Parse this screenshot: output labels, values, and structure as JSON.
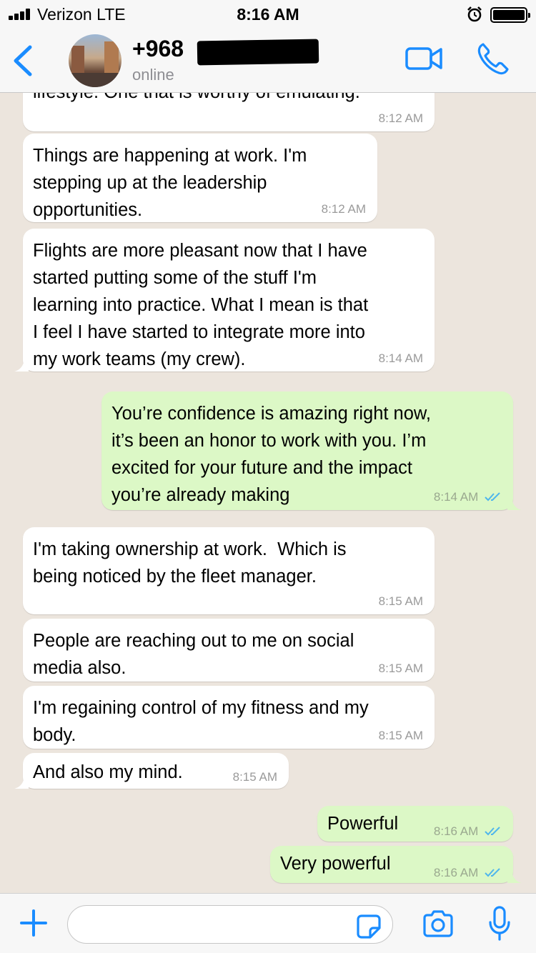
{
  "status_bar": {
    "carrier": "Verizon  LTE",
    "time": "8:16 AM"
  },
  "header": {
    "back_icon": "chevron-left-icon",
    "contact_name": "+968",
    "contact_status": "online",
    "video_icon": "video-camera-icon",
    "call_icon": "phone-icon"
  },
  "messages": [
    {
      "direction": "in",
      "text": "lifestyle. One that is worthy of emulating.",
      "time": "8:12 AM"
    },
    {
      "direction": "in",
      "text": "Things are happening at work. I'm\nstepping up at the leadership\nopportunities.",
      "time": "8:12 AM"
    },
    {
      "direction": "in",
      "text": "Flights are more pleasant now that I have\nstarted putting some of the stuff I'm\nlearning into practice. What I mean is that\nI feel I have started to integrate more into\nmy work teams (my crew).",
      "time": "8:14 AM"
    },
    {
      "direction": "out",
      "text": "You’re confidence is amazing right now,\nit’s been an honor to work with you. I’m\nexcited for your future and the impact\nyou’re already making",
      "time": "8:14 AM",
      "read": true
    },
    {
      "direction": "in",
      "text": "I'm taking ownership at work.  Which is\nbeing noticed by the fleet manager.",
      "time": "8:15 AM"
    },
    {
      "direction": "in",
      "text": "People are reaching out to me on social\nmedia also.",
      "time": "8:15 AM"
    },
    {
      "direction": "in",
      "text": "I'm regaining control of my fitness and my\nbody.",
      "time": "8:15 AM"
    },
    {
      "direction": "in",
      "text": "And also my mind.",
      "time": "8:15 AM"
    },
    {
      "direction": "out",
      "text": "Powerful",
      "time": "8:16 AM",
      "read": true
    },
    {
      "direction": "out",
      "text": "Very powerful",
      "time": "8:16 AM",
      "read": true
    }
  ],
  "input_bar": {
    "plus_icon": "plus-icon",
    "placeholder": "",
    "sticker_icon": "sticker-icon",
    "camera_icon": "camera-icon",
    "mic_icon": "microphone-icon"
  },
  "colors": {
    "accent": "#1a8cff",
    "chat_background": "#ece5dd",
    "incoming_bubble": "#ffffff",
    "outgoing_bubble": "#dcf8c6",
    "read_tick": "#4fb6ec"
  }
}
